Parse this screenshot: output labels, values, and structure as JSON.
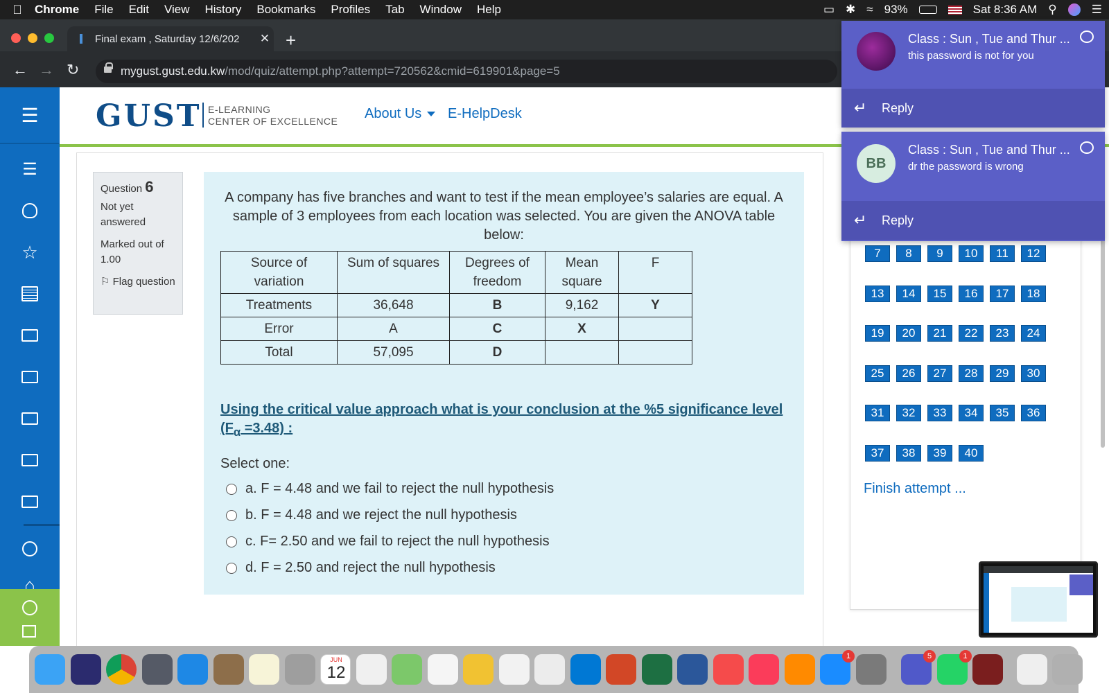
{
  "menubar": {
    "app": "Chrome",
    "items": [
      "File",
      "Edit",
      "View",
      "History",
      "Bookmarks",
      "Profiles",
      "Tab",
      "Window",
      "Help"
    ],
    "battery": "93%",
    "clock": "Sat 8:36 AM"
  },
  "browser": {
    "tab_title": "Final exam , Saturday 12/6/202",
    "url_host": "mygust.gust.edu.kw",
    "url_path": "/mod/quiz/attempt.php?attempt=720562&cmid=619901&page=5"
  },
  "site": {
    "logo": "GUST",
    "logo_sub1": "E-LEARNING",
    "logo_sub2": "CENTER OF EXCELLENCE",
    "nav_about": "About Us",
    "nav_helpdesk": "E-HelpDesk"
  },
  "question": {
    "label": "Question",
    "number": "6",
    "status": "Not yet answered",
    "marked": "Marked out of 1.00",
    "flag": "Flag question",
    "text": "A company has five branches  and want to test if the mean employee’s salaries are equal. A sample of 3 employees from each location was selected. You are given the ANOVA table below:",
    "table": {
      "headers": [
        "Source of variation",
        "Sum of squares",
        "Degrees of freedom",
        "Mean square",
        "F"
      ],
      "rows": [
        [
          "Treatments",
          "36,648",
          "B",
          "9,162",
          "Y"
        ],
        [
          "Error",
          "A",
          "C",
          "X",
          ""
        ],
        [
          "Total",
          "57,095",
          "D",
          "",
          ""
        ]
      ]
    },
    "critical_line1": "Using the critical value approach what is your conclusion at the %5 significance level",
    "critical_line2_pre": "(F",
    "critical_line2_sub": "α",
    "critical_line2_post": " =3.48) :",
    "select_one": "Select one:",
    "options": [
      "a. F = 4.48 and we fail to reject the null hypothesis",
      "b. F = 4.48 and we reject the null hypothesis",
      "c. F= 2.50 and we fail to reject the null hypothesis",
      "d. F = 2.50 and reject the null hypothesis"
    ]
  },
  "quiz_nav": {
    "buttons": [
      "7",
      "8",
      "9",
      "10",
      "11",
      "12",
      "13",
      "14",
      "15",
      "16",
      "17",
      "18",
      "19",
      "20",
      "21",
      "22",
      "23",
      "24",
      "25",
      "26",
      "27",
      "28",
      "29",
      "30",
      "31",
      "32",
      "33",
      "34",
      "35",
      "36",
      "37",
      "38",
      "39",
      "40"
    ],
    "finish": "Finish attempt ..."
  },
  "notifications": [
    {
      "title": "Class : Sun , Tue and Thur ...",
      "body": "this password is not for you",
      "reply": "Reply"
    },
    {
      "title": "Class : Sun , Tue and Thur ...",
      "body": "dr the password is wrong",
      "reply": "Reply",
      "initials": "BB"
    }
  ],
  "dock": {
    "calendar_month": "JUN",
    "calendar_day": "12",
    "badges": [
      "1",
      "5",
      "1"
    ]
  }
}
